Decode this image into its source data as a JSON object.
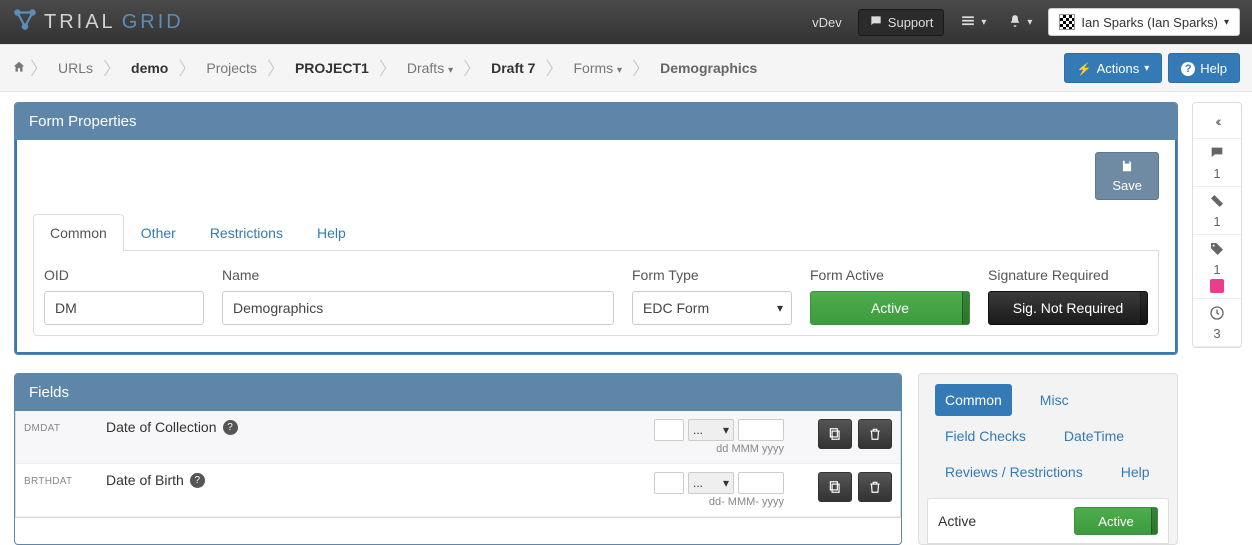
{
  "brand": {
    "name_left": "TRIAL",
    "name_right": "GRID"
  },
  "topnav": {
    "vdev": "vDev",
    "support": "Support",
    "user": "Ian Sparks (Ian Sparks)"
  },
  "breadcrumb": {
    "urls": "URLs",
    "demo": "demo",
    "projects": "Projects",
    "project1": "PROJECT1",
    "drafts": "Drafts",
    "draft7": "Draft 7",
    "forms": "Forms",
    "current": "Demographics",
    "actions": "Actions",
    "help": "Help"
  },
  "panel_form": {
    "title": "Form Properties",
    "save": "Save",
    "tabs": {
      "common": "Common",
      "other": "Other",
      "restrictions": "Restrictions",
      "help": "Help"
    },
    "oid_label": "OID",
    "oid_value": "DM",
    "name_label": "Name",
    "name_value": "Demographics",
    "formtype_label": "Form Type",
    "formtype_value": "EDC Form",
    "formactive_label": "Form Active",
    "formactive_value": "Active",
    "sig_label": "Signature Required",
    "sig_value": "Sig. Not Required"
  },
  "panel_fields": {
    "title": "Fields",
    "rows": [
      {
        "code": "DMDAT",
        "label": "Date of Collection",
        "format": "dd MMM yyyy"
      },
      {
        "code": "BRTHDAT",
        "label": "Date of Birth",
        "format": "dd- MMM- yyyy"
      }
    ],
    "sel_placeholder": "..."
  },
  "sidepanel": {
    "tabs": {
      "common": "Common",
      "misc": "Misc",
      "fieldchecks": "Field Checks",
      "datetime": "DateTime",
      "reviews": "Reviews / Restrictions",
      "help": "Help"
    },
    "active_label": "Active",
    "active_value": "Active"
  },
  "rail": {
    "comments": "1",
    "tickets": "1",
    "tags": "1",
    "history": "3"
  }
}
